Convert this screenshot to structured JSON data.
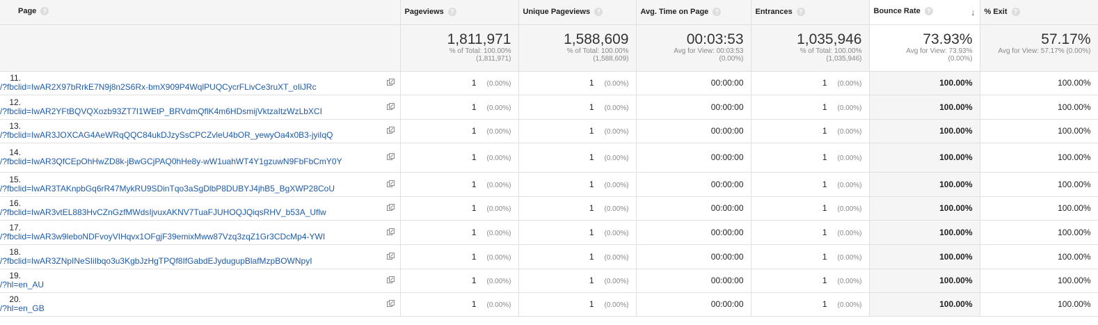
{
  "columns": {
    "page": "Page",
    "pageviews": "Pageviews",
    "unique_pageviews": "Unique Pageviews",
    "avg_time": "Avg. Time on Page",
    "entrances": "Entrances",
    "bounce_rate": "Bounce Rate",
    "exit": "% Exit"
  },
  "help_glyph": "?",
  "sort_glyph": "↓",
  "totals": {
    "pageviews": {
      "value": "1,811,971",
      "line1": "% of Total: 100.00%",
      "line2": "(1,811,971)"
    },
    "unique_pageviews": {
      "value": "1,588,609",
      "line1": "% of Total: 100.00%",
      "line2": "(1,588,609)"
    },
    "avg_time": {
      "value": "00:03:53",
      "line1": "Avg for View: 00:03:53",
      "line2": "(0.00%)"
    },
    "entrances": {
      "value": "1,035,946",
      "line1": "% of Total: 100.00%",
      "line2": "(1,035,946)"
    },
    "bounce_rate": {
      "value": "73.93%",
      "line1": "Avg for View: 73.93%",
      "line2": "(0.00%)"
    },
    "exit": {
      "value": "57.17%",
      "line1": "Avg for View: 57.17% (0.00%)"
    }
  },
  "rows": [
    {
      "idx": "11.",
      "page": "/?fbclid=IwAR2X97bRrkE7N9j8n2S6Rx-bmX909P4WqlPUQCycrFLivCe3ruXT_oIiJRc",
      "pageviews": "1",
      "pv_pct": "(0.00%)",
      "unique": "1",
      "u_pct": "(0.00%)",
      "avg_time": "00:00:00",
      "entrances": "1",
      "e_pct": "(0.00%)",
      "bounce": "100.00%",
      "exit": "100.00%"
    },
    {
      "idx": "12.",
      "page": "/?fbclid=IwAR2YFtBQVQXozb93ZT7I1WEtP_BRVdmQflK4m6HDsmijVktzaItzWzLbXCI",
      "pageviews": "1",
      "pv_pct": "(0.00%)",
      "unique": "1",
      "u_pct": "(0.00%)",
      "avg_time": "00:00:00",
      "entrances": "1",
      "e_pct": "(0.00%)",
      "bounce": "100.00%",
      "exit": "100.00%"
    },
    {
      "idx": "13.",
      "page": "/?fbclid=IwAR3JOXCAG4AeWRqQQC84ukDJzySsCPCZvleU4bOR_yewyOa4x0B3-jyiIqQ",
      "pageviews": "1",
      "pv_pct": "(0.00%)",
      "unique": "1",
      "u_pct": "(0.00%)",
      "avg_time": "00:00:00",
      "entrances": "1",
      "e_pct": "(0.00%)",
      "bounce": "100.00%",
      "exit": "100.00%"
    },
    {
      "idx": "14.",
      "page": "/?fbclid=IwAR3QfCEpOhHwZD8k-jBwGCjPAQ0hHe8y-wW1uahWT4Y1gzuwN9FbFbCmY0Y",
      "pageviews": "1",
      "pv_pct": "(0.00%)",
      "unique": "1",
      "u_pct": "(0.00%)",
      "avg_time": "00:00:00",
      "entrances": "1",
      "e_pct": "(0.00%)",
      "bounce": "100.00%",
      "exit": "100.00%"
    },
    {
      "idx": "15.",
      "page": "/?fbclid=IwAR3TAKnpbGq6rR47MykRU9SDinTqo3aSgDlbP8DUBYJ4jhB5_BgXWP28CoU",
      "pageviews": "1",
      "pv_pct": "(0.00%)",
      "unique": "1",
      "u_pct": "(0.00%)",
      "avg_time": "00:00:00",
      "entrances": "1",
      "e_pct": "(0.00%)",
      "bounce": "100.00%",
      "exit": "100.00%"
    },
    {
      "idx": "16.",
      "page": "/?fbclid=IwAR3vtEL883HvCZnGzfMWdsIjvuxAKNV7TuaFJUHOQJQiqsRHV_b53A_Uflw",
      "pageviews": "1",
      "pv_pct": "(0.00%)",
      "unique": "1",
      "u_pct": "(0.00%)",
      "avg_time": "00:00:00",
      "entrances": "1",
      "e_pct": "(0.00%)",
      "bounce": "100.00%",
      "exit": "100.00%"
    },
    {
      "idx": "17.",
      "page": "/?fbclid=IwAR3w9leboNDFvoyVIHqvx1OFgjF39emixMww87Vzq3zqZ1Gr3CDcMp4-YWI",
      "pageviews": "1",
      "pv_pct": "(0.00%)",
      "unique": "1",
      "u_pct": "(0.00%)",
      "avg_time": "00:00:00",
      "entrances": "1",
      "e_pct": "(0.00%)",
      "bounce": "100.00%",
      "exit": "100.00%"
    },
    {
      "idx": "18.",
      "page": "/?fbclid=IwAR3ZNpINeSIiIbqo3u3KgbJzHgTPQf8IfGabdEJydugupBlafMzpBOWNpyI",
      "pageviews": "1",
      "pv_pct": "(0.00%)",
      "unique": "1",
      "u_pct": "(0.00%)",
      "avg_time": "00:00:00",
      "entrances": "1",
      "e_pct": "(0.00%)",
      "bounce": "100.00%",
      "exit": "100.00%"
    },
    {
      "idx": "19.",
      "page": "/?hl=en_AU",
      "pageviews": "1",
      "pv_pct": "(0.00%)",
      "unique": "1",
      "u_pct": "(0.00%)",
      "avg_time": "00:00:00",
      "entrances": "1",
      "e_pct": "(0.00%)",
      "bounce": "100.00%",
      "exit": "100.00%"
    },
    {
      "idx": "20.",
      "page": "/?hl=en_GB",
      "pageviews": "1",
      "pv_pct": "(0.00%)",
      "unique": "1",
      "u_pct": "(0.00%)",
      "avg_time": "00:00:00",
      "entrances": "1",
      "e_pct": "(0.00%)",
      "bounce": "100.00%",
      "exit": "100.00%"
    }
  ]
}
